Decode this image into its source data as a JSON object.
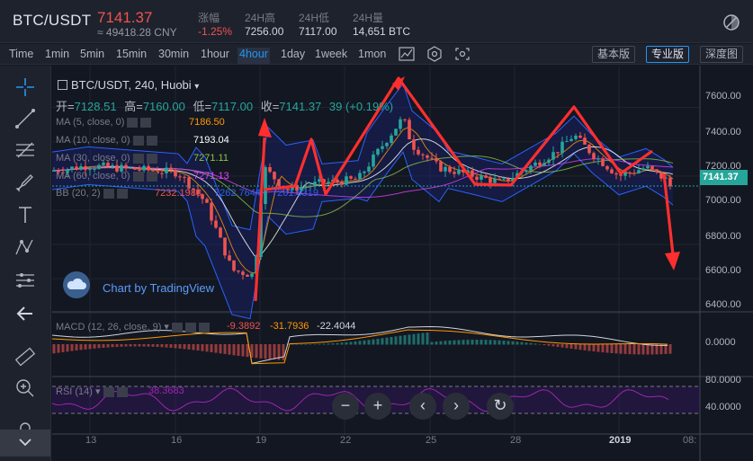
{
  "header": {
    "pair": "BTC/USDT",
    "price": "7141.37",
    "cny": "≈ 49418.28 CNY",
    "stats": [
      {
        "label": "涨幅",
        "value": "-1.25%",
        "color": "#ef5350"
      },
      {
        "label": "24H高",
        "value": "7256.00",
        "color": "#d1d4dc"
      },
      {
        "label": "24H低",
        "value": "7117.00",
        "color": "#d1d4dc"
      },
      {
        "label": "24H量",
        "value": "14,651 BTC",
        "color": "#d1d4dc"
      }
    ]
  },
  "toolbar": {
    "timeframes": [
      "Time",
      "1min",
      "5min",
      "15min",
      "30min",
      "1hour",
      "4hour",
      "1day",
      "1week",
      "1mon"
    ],
    "active_timeframe": "4hour",
    "versions": [
      "基本版",
      "专业版",
      "深度图"
    ],
    "active_version": "专业版"
  },
  "left_tools": [
    "crosshair-icon",
    "trendline-icon",
    "fib-icon",
    "brush-icon",
    "text-icon",
    "pattern-icon",
    "measure-icon",
    "back-arrow-icon",
    "ruler-icon",
    "zoom-in-icon",
    "lock-icon"
  ],
  "legend": {
    "title": "BTC/USDT, 240, Huobi",
    "ohlc": {
      "open_label": "开=",
      "open": "7128.51",
      "high_label": "高=",
      "high": "7160.00",
      "low_label": "低=",
      "low": "7117.00",
      "close_label": "收=",
      "close": "7141.37",
      "change": "39 (+0.19%)"
    }
  },
  "indicators": [
    {
      "label": "MA (5, close, 0)",
      "value": "7186.50",
      "color": "#ff9800"
    },
    {
      "label": "MA (10, close, 0)",
      "value": "7193.04",
      "color": "#ffffff"
    },
    {
      "label": "MA (30, close, 0)",
      "value": "7271.11",
      "color": "#8bc34a"
    },
    {
      "label": "MA (60, close, 0)",
      "value": "7271.13",
      "color": "#e040fb"
    },
    {
      "label": "BB (20, 2)",
      "values": [
        "7232.1988",
        "7262.7644",
        "7201.6319"
      ],
      "colors": [
        "#ef5350",
        "#2962ff",
        "#2962ff"
      ]
    }
  ],
  "macd": {
    "label": "MACD (12, 26, close, 9)",
    "values": [
      "-9.3892",
      "-31.7936",
      "-22.4044"
    ],
    "colors": [
      "#ef5350",
      "#ff9800",
      "#d1d4dc"
    ]
  },
  "rsi": {
    "label": "RSI (14)",
    "value": "38.3683",
    "color": "#9c27b0"
  },
  "watermark": "Chart by TradingView",
  "price_axis": [
    "7600.00",
    "7400.00",
    "7200.00",
    "7000.00",
    "6800.00",
    "6600.00",
    "6400.00"
  ],
  "current_price_tag": "7141.37",
  "macd_axis": [
    "0.0000"
  ],
  "rsi_axis": [
    "80.0000",
    "40.0000"
  ],
  "time_axis": [
    "13",
    "16",
    "19",
    "22",
    "25",
    "28",
    "2019",
    "08:"
  ],
  "controls": [
    "−",
    "+",
    "‹",
    "›",
    "↻"
  ],
  "colors": {
    "up": "#26a69a",
    "down": "#ef5350",
    "accent": "#2196f3",
    "annotation": "#ff2f2f"
  }
}
